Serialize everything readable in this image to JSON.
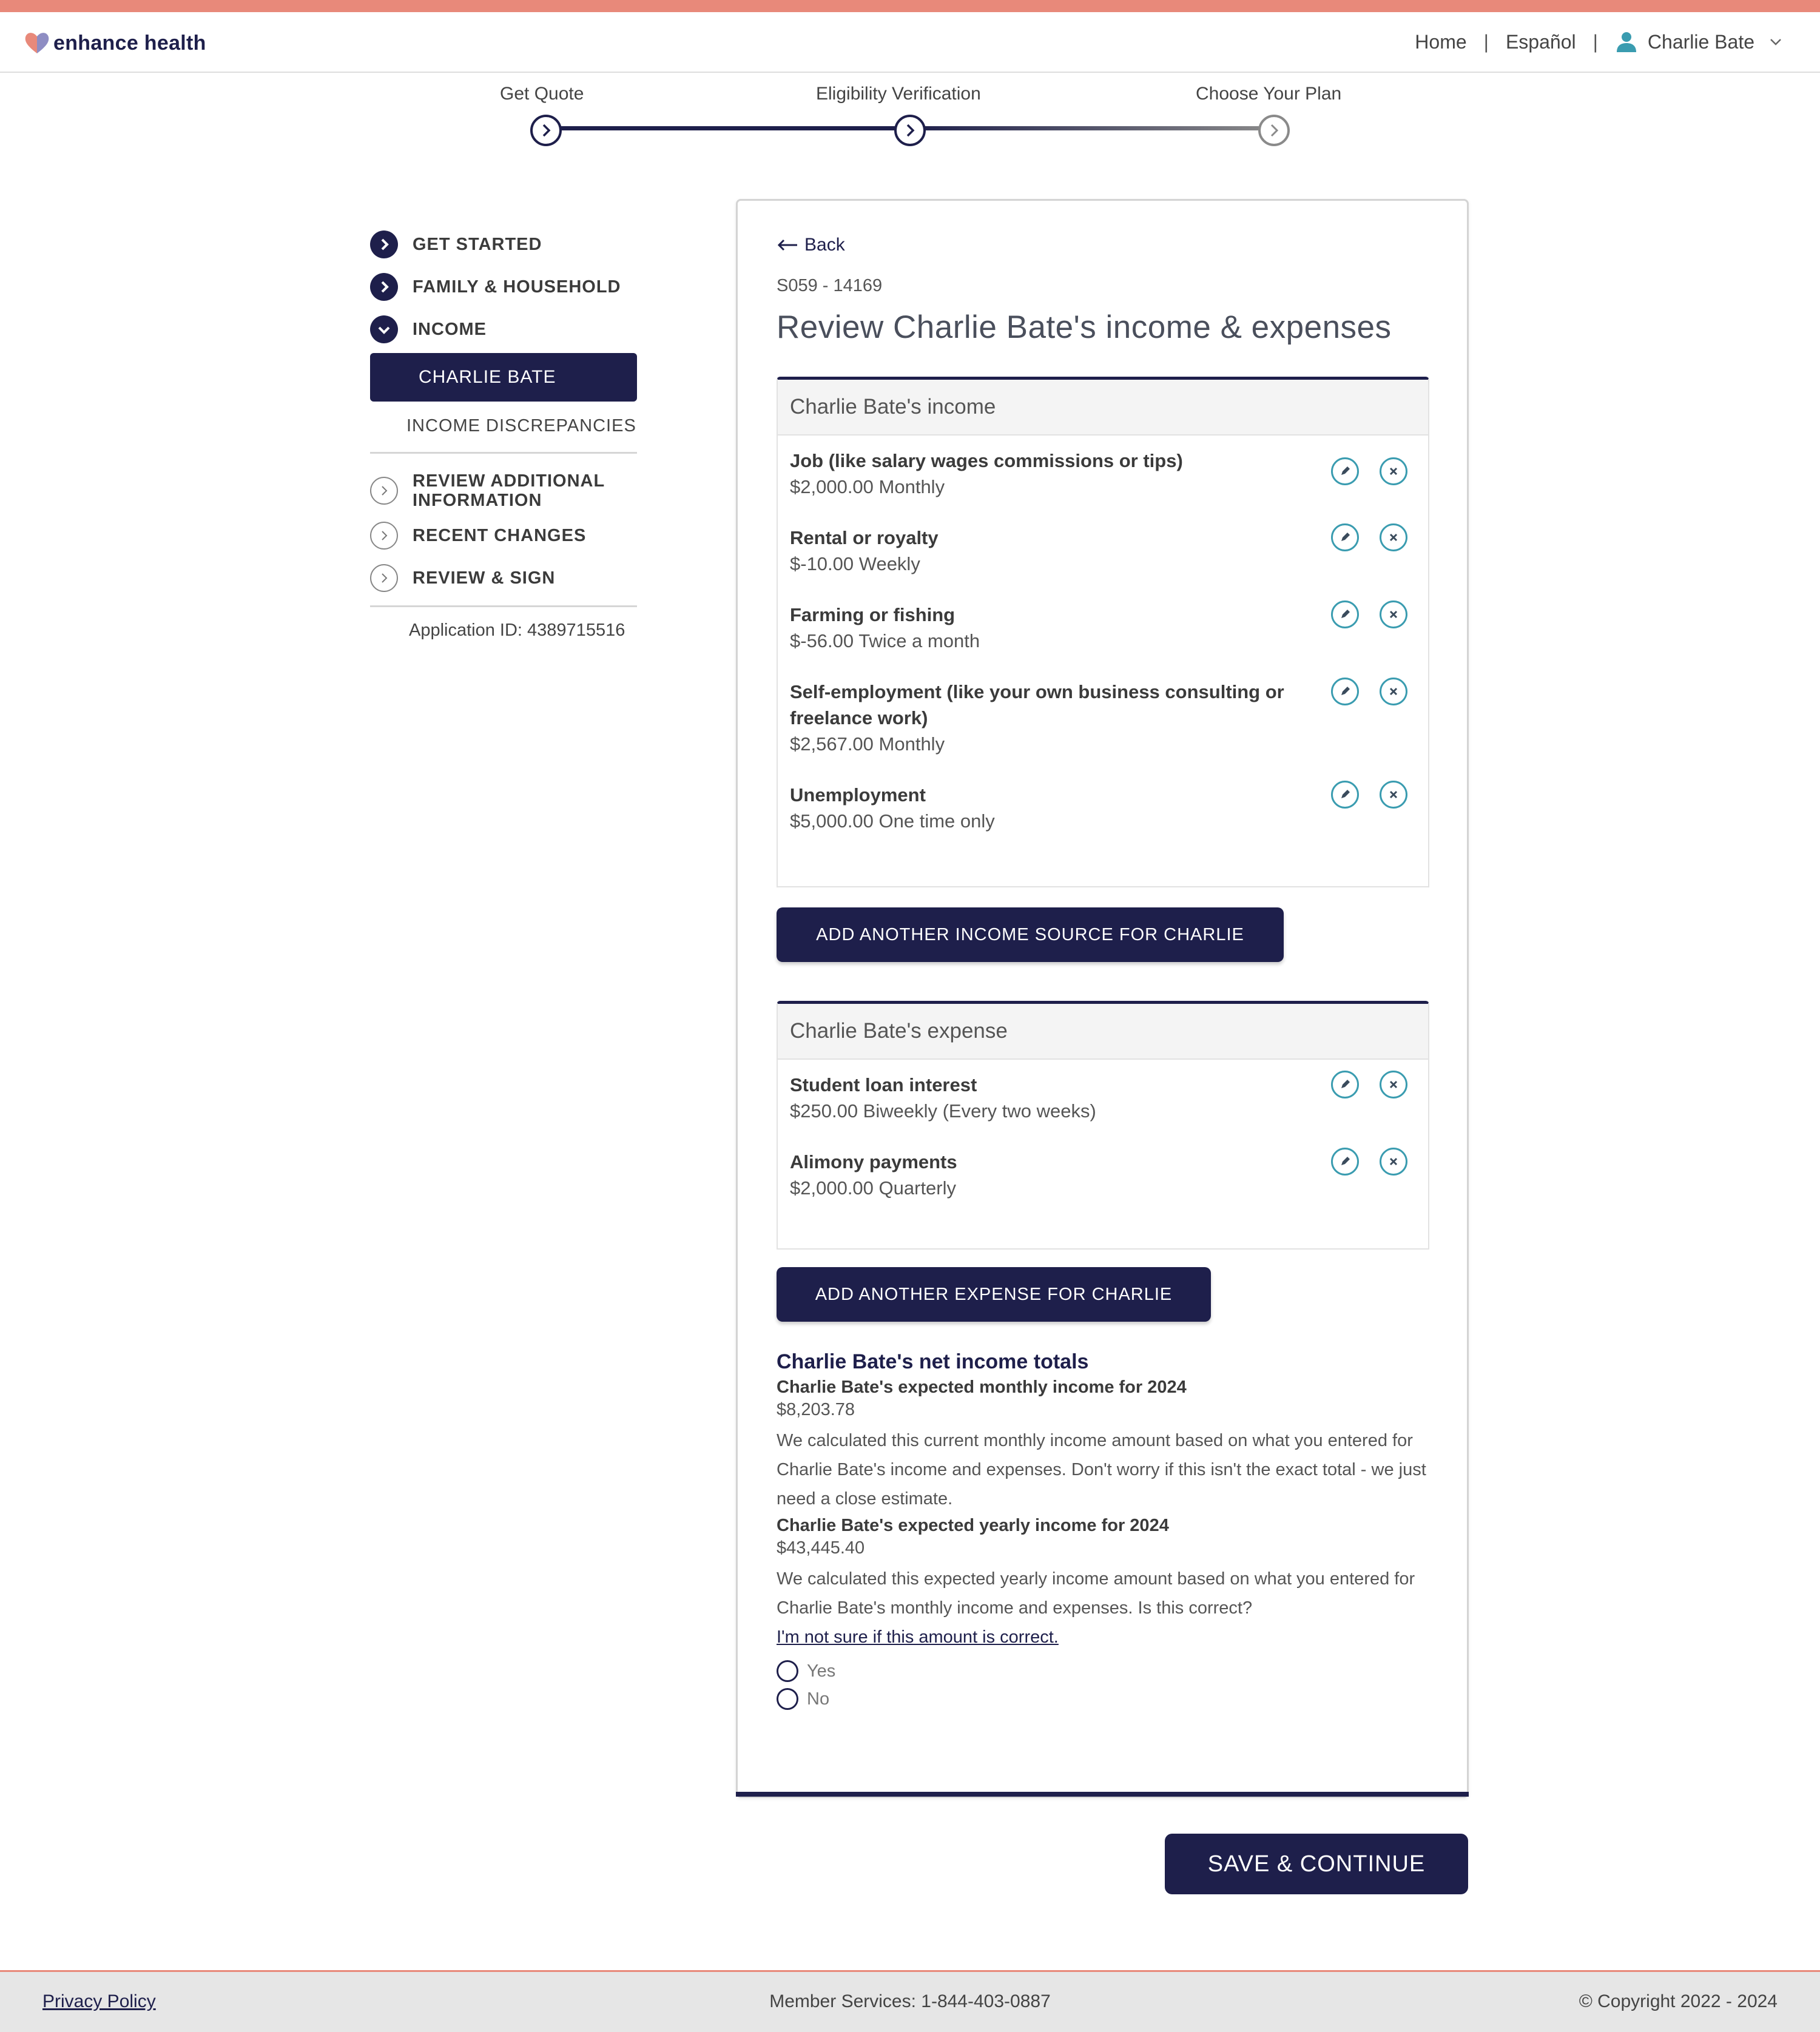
{
  "header": {
    "brand": "enhance health",
    "nav_home": "Home",
    "nav_separator": "|",
    "nav_language": "Español",
    "user_name": "Charlie Bate"
  },
  "stepper": {
    "steps": [
      {
        "label": "Get Quote",
        "state": "complete"
      },
      {
        "label": "Eligibility Verification",
        "state": "current"
      },
      {
        "label": "Choose Your Plan",
        "state": "upcoming"
      }
    ]
  },
  "sidebar": {
    "items": [
      {
        "label": "GET STARTED",
        "state": "done"
      },
      {
        "label": "FAMILY & HOUSEHOLD",
        "state": "done"
      },
      {
        "label": "INCOME",
        "state": "expanded"
      }
    ],
    "active_sub": "CHARLIE BATE",
    "sub_item": "INCOME DISCREPANCIES",
    "later_items": [
      {
        "label_line1": "REVIEW ADDITIONAL",
        "label_line2": "INFORMATION"
      },
      {
        "label": "RECENT CHANGES"
      },
      {
        "label": "REVIEW & SIGN"
      }
    ],
    "application_id": "Application ID: 4389715516"
  },
  "main": {
    "back_label": "Back",
    "code": "S059 - 14169",
    "title": "Review Charlie Bate's income & expenses",
    "income_panel": {
      "heading": "Charlie Bate's income",
      "rows": [
        {
          "title": "Job (like salary wages commissions or tips)",
          "value": "$2,000.00 Monthly"
        },
        {
          "title": "Rental or royalty",
          "value": "$-10.00 Weekly"
        },
        {
          "title": "Farming or fishing",
          "value": "$-56.00 Twice a month"
        },
        {
          "title": "Self-employment (like your own business consulting or freelance work)",
          "value": "$2,567.00 Monthly"
        },
        {
          "title": "Unemployment",
          "value": "$5,000.00 One time only"
        }
      ]
    },
    "add_income_label": "ADD ANOTHER INCOME SOURCE FOR CHARLIE",
    "expense_panel": {
      "heading": "Charlie Bate's expense",
      "rows": [
        {
          "title": "Student loan interest",
          "value": "$250.00 Biweekly (Every two weeks)"
        },
        {
          "title": "Alimony payments",
          "value": "$2,000.00 Quarterly"
        }
      ]
    },
    "add_expense_label": "ADD ANOTHER EXPENSE FOR CHARLIE",
    "totals": {
      "heading": "Charlie Bate's net income totals",
      "monthly_label": "Charlie Bate's expected monthly income for 2024",
      "monthly_amount": "$8,203.78",
      "monthly_note": "We calculated this current monthly income amount based on what you entered for Charlie Bate's income and expenses. Don't worry if this isn't the exact total - we just need a close estimate.",
      "yearly_label": "Charlie Bate's expected yearly income for 2024",
      "yearly_amount": "$43,445.40",
      "yearly_note": "We calculated this expected yearly income amount based on what you entered for Charlie Bate's monthly income and expenses. Is this correct?",
      "unsure_link": "I'm not sure if this amount is correct.",
      "option_yes": "Yes",
      "option_no": "No"
    },
    "save_label": "SAVE & CONTINUE"
  },
  "footer": {
    "privacy": "Privacy Policy",
    "member_services": "Member Services: 1-844-403-0887",
    "copyright": "© Copyright 2022 - 2024"
  },
  "colors": {
    "accent_coral": "#e8897a",
    "navy": "#1e1f4b",
    "teal_icon": "#3a9cb0"
  }
}
